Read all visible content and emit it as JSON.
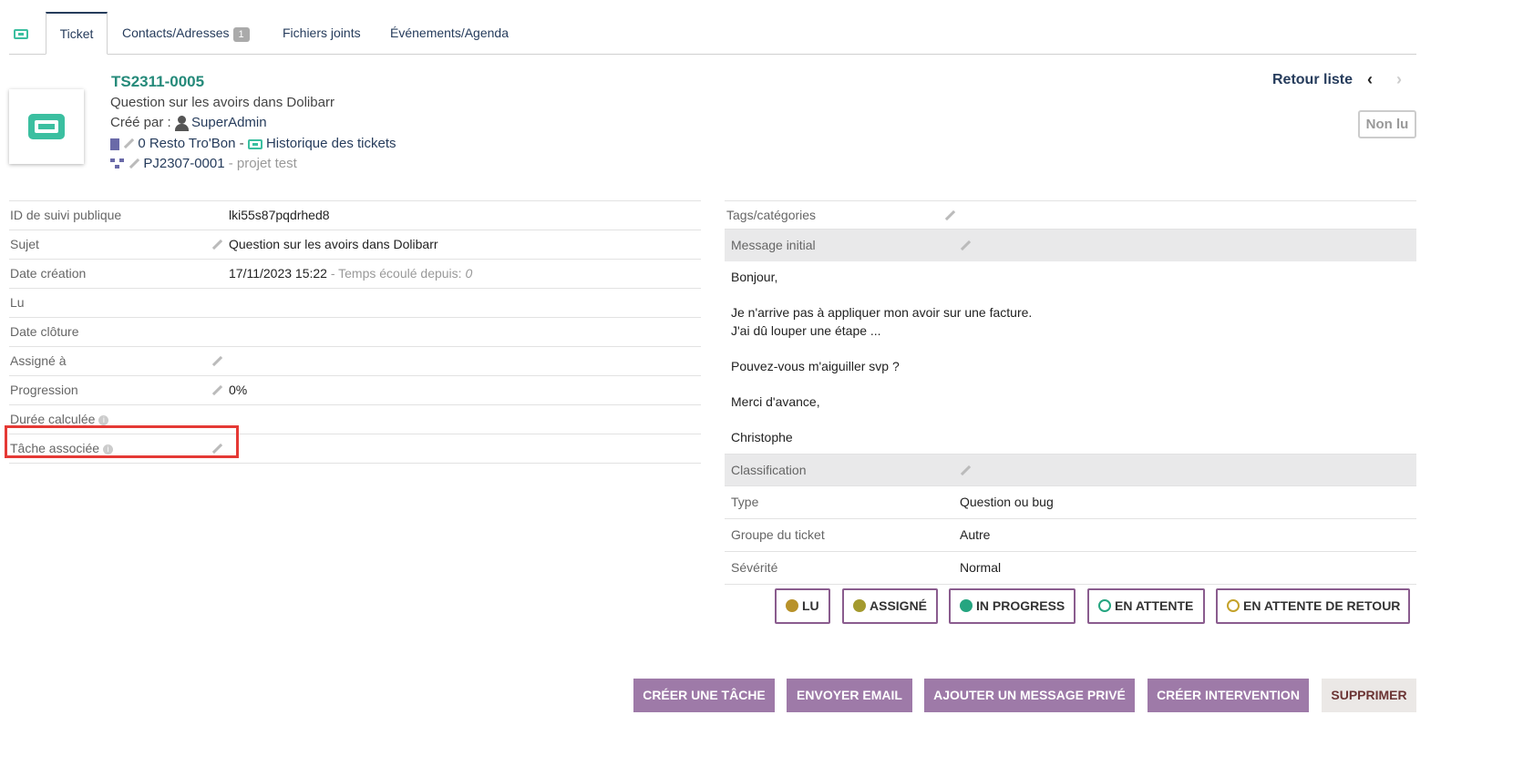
{
  "tabs": {
    "ticket": "Ticket",
    "contacts": "Contacts/Adresses",
    "contacts_count": "1",
    "files": "Fichiers joints",
    "events": "Événements/Agenda"
  },
  "header": {
    "ref": "TS2311-0005",
    "subject": "Question sur les avoirs dans Dolibarr",
    "created_by_label": "Créé par :",
    "created_by": "SuperAdmin",
    "thirdparty": "0 Resto Tro'Bon",
    "separator": "-",
    "history_link": "Historique des tickets",
    "project_ref": "PJ2307-0001",
    "project_label": "- projet test",
    "back_list": "Retour liste",
    "prev": "‹",
    "next": "›",
    "unread_badge": "Non lu"
  },
  "left_fields": {
    "public_id_label": "ID de suivi publique",
    "public_id": "lki55s87pqdrhed8",
    "subject_label": "Sujet",
    "subject": "Question sur les avoirs dans Dolibarr",
    "created_label": "Date création",
    "created": "17/11/2023 15:22",
    "elapsed_label": "- Temps écoulé depuis:",
    "elapsed": "0",
    "read_label": "Lu",
    "closed_label": "Date clôture",
    "assigned_label": "Assigné à",
    "progress_label": "Progression",
    "progress": "0%",
    "duration_label": "Durée calculée",
    "task_label": "Tâche associée"
  },
  "right_fields": {
    "tags_label": "Tags/catégories",
    "message_label": "Message initial",
    "message_lines": [
      "Bonjour,",
      "",
      "Je n'arrive pas à appliquer mon avoir sur une facture.",
      "J'ai dû louper une étape ...",
      "",
      "Pouvez-vous m'aiguiller svp ?",
      "",
      "Merci d'avance,",
      "",
      "Christophe"
    ],
    "classification_label": "Classification",
    "type_label": "Type",
    "type": "Question ou bug",
    "group_label": "Groupe du ticket",
    "group": "Autre",
    "severity_label": "Sévérité",
    "severity": "Normal"
  },
  "statuses": [
    {
      "label": "LU",
      "color": "#b8922a",
      "filled": true
    },
    {
      "label": "ASSIGNÉ",
      "color": "#a49a2e",
      "filled": true
    },
    {
      "label": "IN PROGRESS",
      "color": "#25a580",
      "filled": true
    },
    {
      "label": "EN ATTENTE",
      "color": "#25a580",
      "filled": false
    },
    {
      "label": "EN ATTENTE DE RETOUR",
      "color": "#c4a22a",
      "filled": false
    }
  ],
  "actions": {
    "create_task": "CRÉER UNE TÂCHE",
    "send_email": "ENVOYER EMAIL",
    "private_msg": "AJOUTER UN MESSAGE PRIVÉ",
    "create_intervention": "CRÉER INTERVENTION",
    "delete": "SUPPRIMER"
  }
}
